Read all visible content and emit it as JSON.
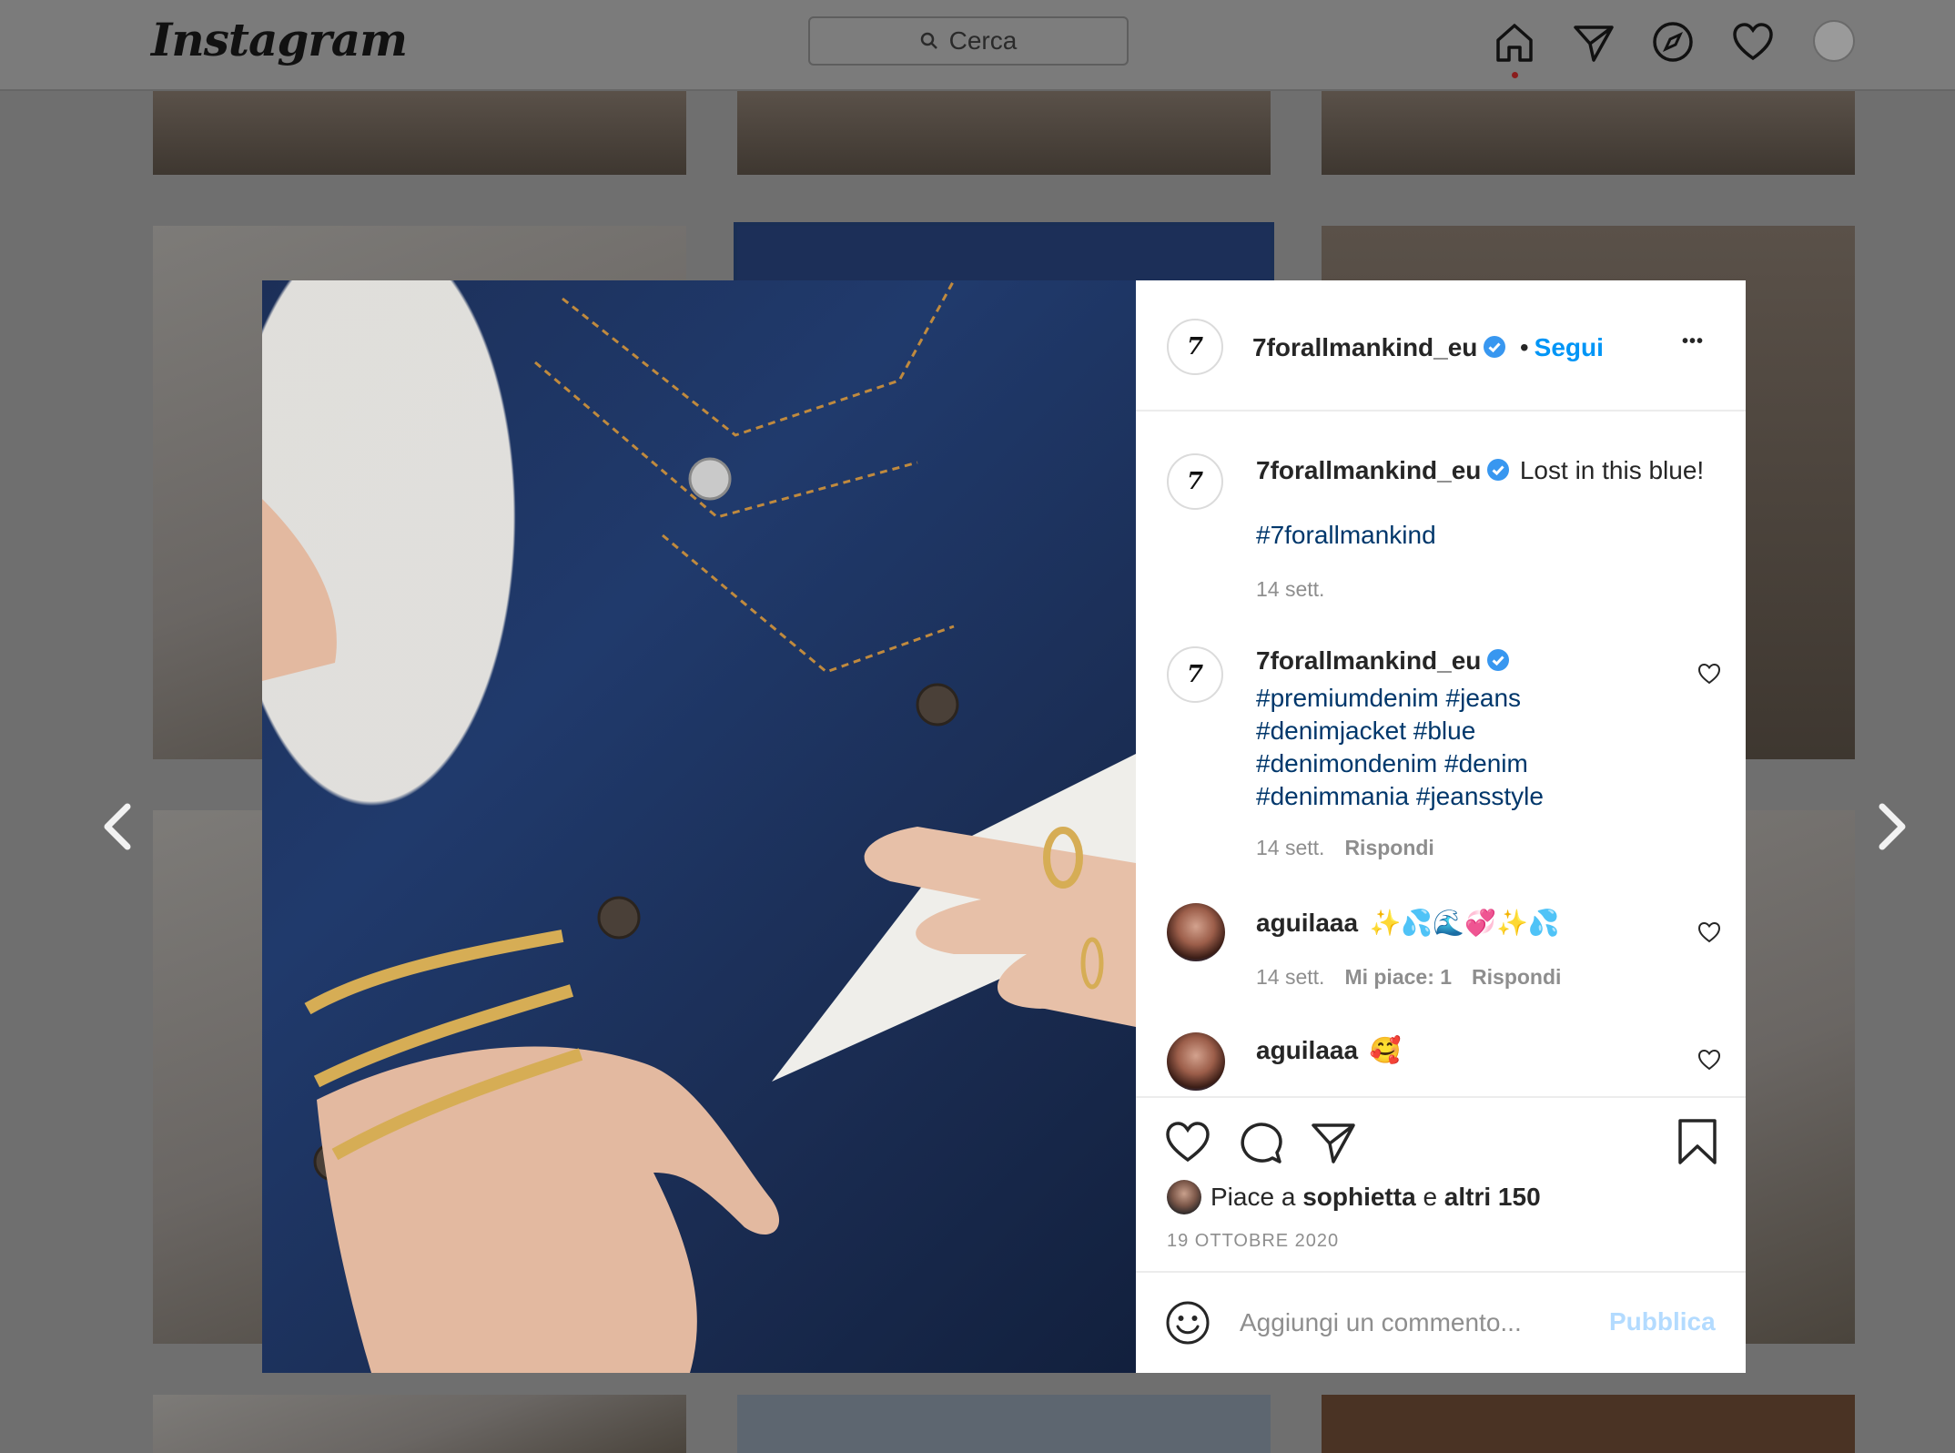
{
  "app": {
    "logo": "Instagram"
  },
  "search": {
    "placeholder": "Cerca"
  },
  "nav": {
    "icons": [
      "home-icon",
      "direct-icon",
      "explore-icon",
      "activity-heart-icon",
      "profile-avatar"
    ]
  },
  "post": {
    "author": "7forallmankind_eu",
    "follow_label": "Segui",
    "separator": "•",
    "logo_glyph": "7",
    "more_label": "•••",
    "caption": {
      "username": "7forallmankind_eu",
      "text": "Lost in this blue!",
      "hashtag": "#7forallmankind",
      "time": "14 sett."
    },
    "comments": [
      {
        "username": "7forallmankind_eu",
        "lines": [
          "#premiumdenim #jeans",
          "#denimjacket #blue",
          "#denimondenim #denim",
          "#denimmania #jeansstyle"
        ],
        "time": "14 sett.",
        "reply": "Rispondi"
      },
      {
        "username": "aguilaaa",
        "text": "✨💦🌊💞✨💦",
        "time": "14 sett.",
        "likes": "Mi piace: 1",
        "reply": "Rispondi"
      },
      {
        "username": "aguilaaa",
        "text": "🥰"
      }
    ],
    "likes": {
      "prefix": "Piace a",
      "user": "sophietta",
      "conj": "e",
      "others": "altri 150"
    },
    "date": "19 OTTOBRE 2020",
    "add_comment": {
      "placeholder": "Aggiungi un commento...",
      "publish": "Pubblica"
    }
  },
  "colors": {
    "link": "#0095f6",
    "hashtag": "#00376b",
    "meta": "#8e8e8e",
    "publish_disabled": "#b3dbff",
    "overlay": "#6f6f6f"
  }
}
